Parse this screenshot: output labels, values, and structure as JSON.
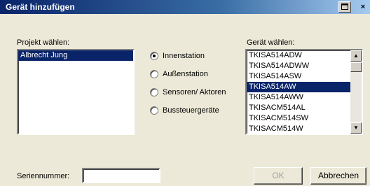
{
  "window": {
    "title": "Gerät hinzufügen"
  },
  "titlebar": {
    "restore_icon": "window-icon",
    "close_glyph": "×"
  },
  "project": {
    "label": "Projekt wählen:",
    "items": [
      {
        "label": "Albrecht Jung",
        "selected": true
      }
    ]
  },
  "station_type": {
    "options": [
      {
        "label": "Innenstation",
        "selected": true
      },
      {
        "label": "Außenstation",
        "selected": false
      },
      {
        "label": "Sensoren/ Aktoren",
        "selected": false
      },
      {
        "label": "Bussteuergeräte",
        "selected": false
      }
    ]
  },
  "device": {
    "label": "Gerät wählen:",
    "items": [
      {
        "label": "TKISA514ADW",
        "selected": false
      },
      {
        "label": "TKISA514ADWW",
        "selected": false
      },
      {
        "label": "TKISA514ASW",
        "selected": false
      },
      {
        "label": "TKISA514AW",
        "selected": true
      },
      {
        "label": "TKISA514AWW",
        "selected": false
      },
      {
        "label": "TKISACM514AL",
        "selected": false
      },
      {
        "label": "TKISACM514SW",
        "selected": false
      },
      {
        "label": "TKISACM514W",
        "selected": false
      }
    ]
  },
  "serial": {
    "label": "Seriennummer:",
    "value": ""
  },
  "buttons": {
    "ok": "OK",
    "cancel": "Abbrechen"
  }
}
